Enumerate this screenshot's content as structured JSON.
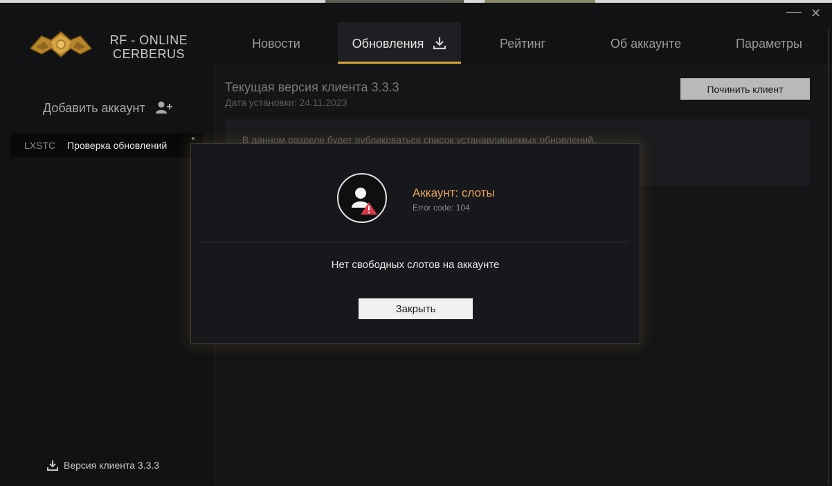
{
  "app": {
    "logo_text_line1": "RF - ONLINE",
    "logo_text_line2": "CERBERUS",
    "window_controls": {
      "minimize": "—",
      "close": "✕"
    }
  },
  "nav": {
    "tabs": [
      {
        "label": "Новости"
      },
      {
        "label": "Обновления",
        "active": true,
        "icon": "download-icon"
      },
      {
        "label": "Рейтинг"
      },
      {
        "label": "Об аккаунте"
      },
      {
        "label": "Параметры"
      }
    ]
  },
  "sidebar": {
    "add_account_label": "Добавить аккаунт",
    "add_account_icon": "add-user-icon",
    "account": {
      "name": "LXSTC",
      "status": "Проверка обновлений"
    },
    "client_version_label": "Версия клиента 3.3.3"
  },
  "main": {
    "current_version": "Текущая версия клиента 3.3.3",
    "install_date": "Дата установки: 24.11.2023",
    "repair_button": "Починить клиент",
    "info_text": "В данном разделе будет публиковаться список устанавливаемых обновлений."
  },
  "modal": {
    "title": "Аккаунт: слоты",
    "error_code": "Error code: 104",
    "message": "Нет свободных слотов на аккаунте",
    "close_button": "Закрыть",
    "icon": "user-warning-icon"
  },
  "colors": {
    "accent": "#d7a23a",
    "modal_title": "#e8a35a",
    "warning": "#d23a48"
  }
}
